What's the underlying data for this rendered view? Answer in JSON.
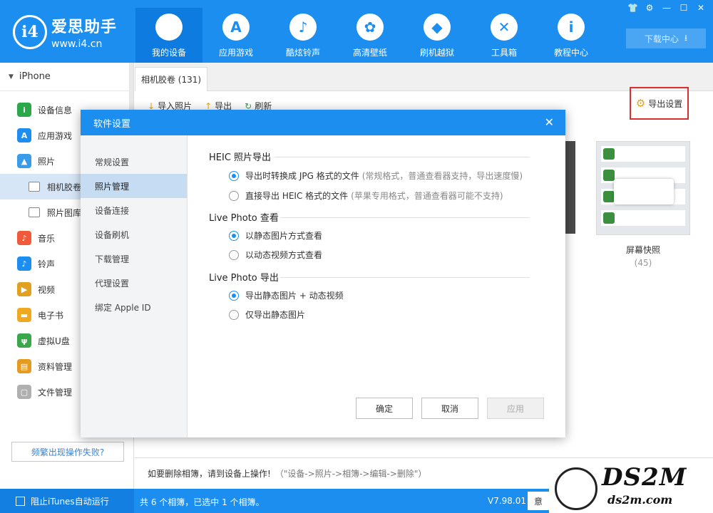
{
  "app": {
    "logo_mark": "i4",
    "name": "爱思助手",
    "url": "www.i4.cn"
  },
  "nav": [
    {
      "label": "我的设备",
      "icon": "apple-icon",
      "glyph": ""
    },
    {
      "label": "应用游戏",
      "icon": "appstore-icon",
      "glyph": "A"
    },
    {
      "label": "酷炫铃声",
      "icon": "bell-icon",
      "glyph": "♪"
    },
    {
      "label": "高清壁纸",
      "icon": "flower-icon",
      "glyph": "✿"
    },
    {
      "label": "刷机越狱",
      "icon": "dropbox-icon",
      "glyph": "◆"
    },
    {
      "label": "工具箱",
      "icon": "tools-icon",
      "glyph": "✕"
    },
    {
      "label": "教程中心",
      "icon": "info-icon",
      "glyph": "i"
    }
  ],
  "window_controls": [
    "👕",
    "⚙",
    "—",
    "☐",
    "✕"
  ],
  "download_center": "下载中心",
  "sidebar": {
    "device": "iPhone",
    "items": [
      {
        "label": "设备信息",
        "icon": "info-icon",
        "color": "#2aa84a",
        "glyph": "i"
      },
      {
        "label": "应用游戏",
        "icon": "appstore-icon",
        "color": "#1b8ef0",
        "glyph": "A"
      },
      {
        "label": "照片",
        "icon": "photo-icon",
        "color": "#3a9be8",
        "glyph": "▲"
      },
      {
        "label": "相机胶卷",
        "icon": "folder-icon",
        "sub": true,
        "active": true
      },
      {
        "label": "照片图库",
        "icon": "folder-icon",
        "sub": true
      },
      {
        "label": "音乐",
        "icon": "music-icon",
        "color": "#f05a3a",
        "glyph": "♪"
      },
      {
        "label": "铃声",
        "icon": "bell-icon",
        "color": "#1b8ef0",
        "glyph": "♪"
      },
      {
        "label": "视频",
        "icon": "video-icon",
        "color": "#e0a020",
        "glyph": "▶"
      },
      {
        "label": "电子书",
        "icon": "book-icon",
        "color": "#f0a820",
        "glyph": "▬"
      },
      {
        "label": "虚拟U盘",
        "icon": "usb-icon",
        "color": "#3aa84a",
        "glyph": "ψ"
      },
      {
        "label": "资料管理",
        "icon": "contacts-icon",
        "color": "#e59a20",
        "glyph": "▤"
      },
      {
        "label": "文件管理",
        "icon": "file-icon",
        "color": "#b0b0b0",
        "glyph": "▢"
      }
    ],
    "warn_button": "频繁出现操作失败?"
  },
  "main": {
    "tab": "相机胶卷 (131)",
    "toolbar": [
      {
        "label": "导入照片",
        "icon": "import-icon",
        "glyph": "↓"
      },
      {
        "label": "导出",
        "icon": "export-icon",
        "glyph": "↑"
      },
      {
        "label": "刷新",
        "icon": "refresh-icon",
        "glyph": "↻"
      }
    ],
    "export_settings": "导出设置",
    "album": {
      "name": "屏幕快照",
      "count": "(45)"
    },
    "hint": "如要删除相簿，请到设备上操作!",
    "hint_path": "（\"设备->照片->相簿->编辑->删除\"）"
  },
  "status": {
    "itunes_block": "阻止iTunes自动运行",
    "summary": "共 6 个相簿，已选中 1 个相簿。",
    "version": "V7.98.01",
    "button": "意"
  },
  "watermark": {
    "main": "DS2M",
    "sub": "ds2m.com"
  },
  "dialog": {
    "title": "软件设置",
    "close": "✕",
    "nav": [
      "常规设置",
      "照片管理",
      "设备连接",
      "设备刷机",
      "下载管理",
      "代理设置",
      "绑定 Apple ID"
    ],
    "sections": [
      {
        "title": "HEIC 照片导出",
        "options": [
          {
            "label": "导出时转换成 JPG 格式的文件",
            "hint": "(常规格式，普通查看器支持，导出速度慢)",
            "checked": true
          },
          {
            "label": "直接导出 HEIC 格式的文件",
            "hint": "(苹果专用格式，普通查看器可能不支持)",
            "checked": false
          }
        ]
      },
      {
        "title": "Live Photo 查看",
        "options": [
          {
            "label": "以静态图片方式查看",
            "hint": "",
            "checked": true
          },
          {
            "label": "以动态视频方式查看",
            "hint": "",
            "checked": false
          }
        ]
      },
      {
        "title": "Live Photo 导出",
        "options": [
          {
            "label": "导出静态图片 + 动态视频",
            "hint": "",
            "checked": true
          },
          {
            "label": "仅导出静态图片",
            "hint": "",
            "checked": false
          }
        ]
      }
    ],
    "buttons": {
      "ok": "确定",
      "cancel": "取消",
      "apply": "应用"
    }
  }
}
